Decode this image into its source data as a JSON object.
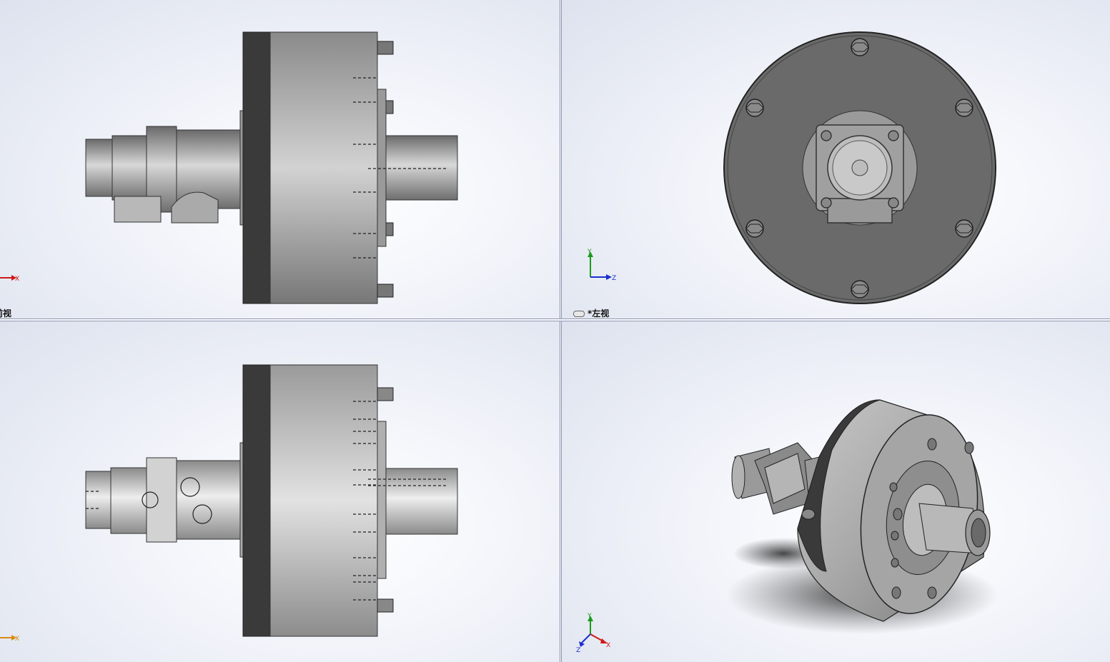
{
  "views": {
    "front": {
      "label": "前视"
    },
    "left": {
      "label": "*左视"
    },
    "top": {
      "label": ""
    },
    "iso": {
      "label": ""
    }
  },
  "axes": {
    "x": "X",
    "y": "Y",
    "z": "Z"
  },
  "colors": {
    "x_axis": "#d01818",
    "y_axis": "#1c9a1c",
    "z_axis": "#1a2fd0",
    "x_axis_top": "#d98a10",
    "body_dark": "#5e5e5e",
    "body_light": "#b4b4b4",
    "flange_dark": "#3a3a3a"
  }
}
